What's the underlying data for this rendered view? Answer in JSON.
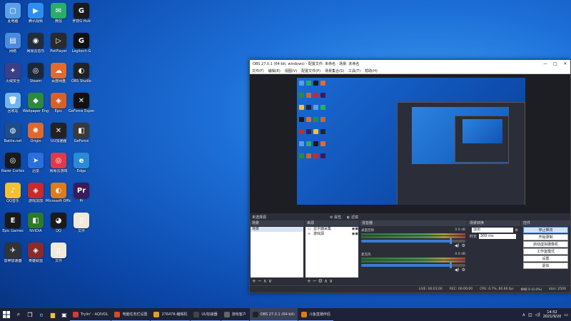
{
  "desktop": {
    "icons": [
      {
        "label": "此电脑",
        "color": "#5aa0e8",
        "glyph": "▢"
      },
      {
        "label": "腾讯视频",
        "color": "#2f8ef0",
        "glyph": "▶"
      },
      {
        "label": "微信",
        "color": "#2aae67",
        "glyph": "✉"
      },
      {
        "label": "罗技G Hub",
        "color": "#1a1a1a",
        "glyph": "G"
      },
      {
        "label": "网络",
        "color": "#4a8be0",
        "glyph": "▤"
      },
      {
        "label": "网易云音乐",
        "color": "#222d3a",
        "glyph": "◉"
      },
      {
        "label": "PotPlayer",
        "color": "#2a2a2a",
        "glyph": "▷"
      },
      {
        "label": "Logitech G",
        "color": "#101010",
        "glyph": "G"
      },
      {
        "label": "火绒安全",
        "color": "#3b3f8a",
        "glyph": "✦"
      },
      {
        "label": "Steam",
        "color": "#1b2838",
        "glyph": "◎"
      },
      {
        "label": "百度网盘",
        "color": "#e26b2c",
        "glyph": "☁"
      },
      {
        "label": "OBS Studio",
        "color": "#222",
        "glyph": "◐"
      },
      {
        "label": "回收站",
        "color": "#6fb4f0",
        "glyph": "🗑"
      },
      {
        "label": "Wallpaper Engine",
        "color": "#2c8a3c",
        "glyph": "◆"
      },
      {
        "label": "Epic",
        "color": "#d8612a",
        "glyph": "◈"
      },
      {
        "label": "GeForce Experience",
        "color": "#111",
        "glyph": "✕"
      },
      {
        "label": "Battle.net",
        "color": "#1f4d8a",
        "glyph": "◍"
      },
      {
        "label": "Origin",
        "color": "#e0682a",
        "glyph": "✺"
      },
      {
        "label": "UU加速器",
        "color": "#222",
        "glyph": "✕"
      },
      {
        "label": "GeForce",
        "color": "#3a3a3a",
        "glyph": "◧"
      },
      {
        "label": "Razer Cortex",
        "color": "#1a1a1a",
        "glyph": "◎"
      },
      {
        "label": "迅雷",
        "color": "#2a6fe0",
        "glyph": "➤"
      },
      {
        "label": "网易云游戏",
        "color": "#e03a4a",
        "glyph": "◎"
      },
      {
        "label": "Edge",
        "color": "#2a8ad6",
        "glyph": "e"
      },
      {
        "label": "QQ音乐",
        "color": "#f2c232",
        "glyph": "♪"
      },
      {
        "label": "游戏加加",
        "color": "#c82a2a",
        "glyph": "◈"
      },
      {
        "label": "Microsoft Office",
        "color": "#e27a1a",
        "glyph": "◐"
      },
      {
        "label": "Pr",
        "color": "#3a1a5a",
        "glyph": "Pr"
      },
      {
        "label": "Epic Games",
        "color": "#1a1a1a",
        "glyph": "E"
      },
      {
        "label": "NVIDIA",
        "color": "#2a7a2a",
        "glyph": "◧"
      },
      {
        "label": "QQ",
        "color": "#1a1a1a",
        "glyph": "◕"
      },
      {
        "label": "文件",
        "color": "#f0eadc",
        "glyph": "▯"
      },
      {
        "label": "雷神加速器",
        "color": "#333",
        "glyph": "✈"
      },
      {
        "label": "英雄联盟",
        "color": "#8a2a2a",
        "glyph": "◈"
      },
      {
        "label": "文件",
        "color": "#f0eadc",
        "glyph": "▯"
      }
    ]
  },
  "obs": {
    "title": "OBS 27.0.1 (64-bit, windows) - 配置文件: 未命名 - 场景: 未命名",
    "menu": [
      "文件(F)",
      "编辑(E)",
      "视图(V)",
      "配置文件(P)",
      "场景集合(S)",
      "工具(T)",
      "帮助(H)"
    ],
    "scene_label": "未选择源",
    "props_label": "属性",
    "filters_label": "滤镜",
    "docks": {
      "scenes": {
        "title": "场景",
        "items": [
          "场景"
        ]
      },
      "sources": {
        "title": "来源",
        "items": [
          {
            "icon": "▭",
            "name": "显示器采集"
          },
          {
            "icon": "∞",
            "name": "游戏源"
          }
        ]
      },
      "mixer": {
        "title": "混音器",
        "channels": [
          {
            "name": "桌面音频",
            "db": "0.0 dB",
            "level": 0.85
          },
          {
            "name": "麦克风",
            "db": "0.0 dB",
            "level": 0.85
          }
        ]
      },
      "transitions": {
        "title": "场景转换",
        "type": "淡出",
        "duration_label": "时长",
        "duration": "300 ms"
      },
      "controls": {
        "title": "控件",
        "buttons": [
          "停止推流",
          "开始录制",
          "启动虚拟摄像机",
          "工作室模式",
          "设置",
          "退出"
        ]
      }
    },
    "status": {
      "live": "LIVE: 00:01:00",
      "rec": "REC: 00:00:00",
      "cpu": "CPU: 0.7%, 60.00 fps",
      "dropped": "掉帧 0 (0.0%)",
      "kbps": "kb/s: 2500"
    }
  },
  "taskbar": {
    "apps": [
      {
        "label": "Trylin' - AQIVOL",
        "color": "#d23b3b"
      },
      {
        "label": "电脑任务栏设置",
        "color": "#d84a2a"
      },
      {
        "label": "276478-编辑机",
        "color": "#e0a020"
      },
      {
        "label": "UU加速器",
        "color": "#444"
      },
      {
        "label": "游戏客户",
        "color": "#666"
      },
      {
        "label": "OBS 27.0.1 (64-bit)",
        "color": "#222",
        "active": true
      },
      {
        "label": "斗鱼直播伴侣",
        "color": "#e07a1a"
      }
    ],
    "time": "14:52",
    "date": "2021/9/20"
  }
}
